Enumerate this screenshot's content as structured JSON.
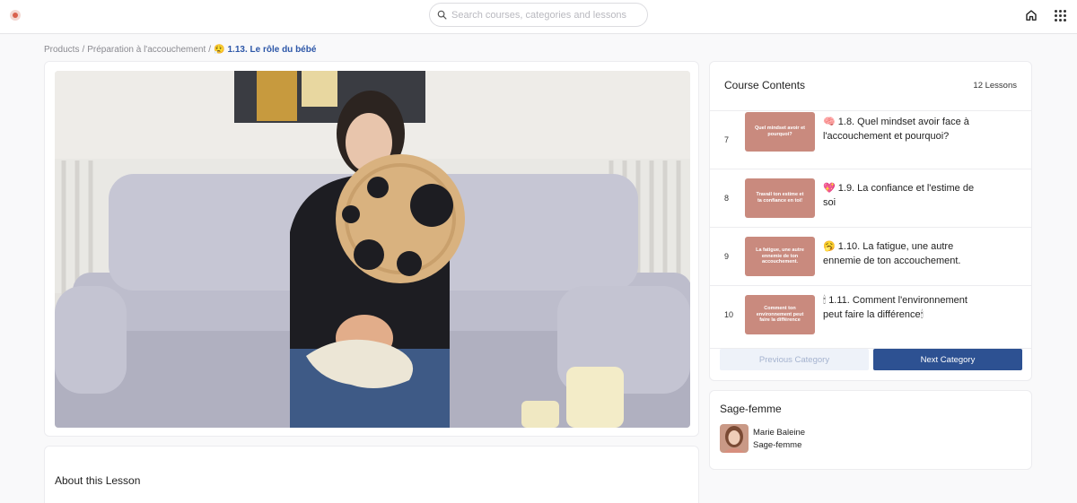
{
  "search": {
    "placeholder": "Search courses, categories and lessons"
  },
  "breadcrumb": {
    "items": [
      "Products",
      "Préparation à l'accouchement"
    ],
    "current_emoji": "😮‍💨",
    "current": "1.13. Le rôle du bébé",
    "separator": "/"
  },
  "about": {
    "title": "About this Lesson"
  },
  "contents": {
    "title": "Course Contents",
    "count": "12 Lessons",
    "lessons": [
      {
        "number": "7",
        "thumb_text": "Quel mindset avoir et pourquoi?",
        "emoji": "🧠",
        "title": "1.8. Quel mindset avoir face à l'accouchement et pourquoi?"
      },
      {
        "number": "8",
        "thumb_text": "Travail ton estime et ta confiance en toi!",
        "emoji": "💖",
        "title": "1.9. La confiance et l'estime de soi"
      },
      {
        "number": "9",
        "thumb_text": "La fatigue, une autre ennemie de ton accouchement.",
        "emoji": "🥱",
        "title": "1.10. La fatigue, une autre ennemie de ton accouchement."
      },
      {
        "number": "10",
        "thumb_text": "Comment ton environnement peut faire la différence",
        "emoji": "🕯",
        "title": "1.11. Comment l'environnement peut faire la différence🕯"
      }
    ],
    "prev_label": "Previous Category",
    "next_label": "Next Category"
  },
  "author": {
    "heading": "Sage-femme",
    "name": "Marie Baleine",
    "role": "Sage-femme"
  },
  "colors": {
    "accent": "#2d5192",
    "breadcrumb_current": "#2d57a8",
    "thumb": "#c98a7e"
  },
  "icons": {
    "search": "search-icon",
    "home": "home-icon",
    "apps": "apps-grid-icon"
  }
}
